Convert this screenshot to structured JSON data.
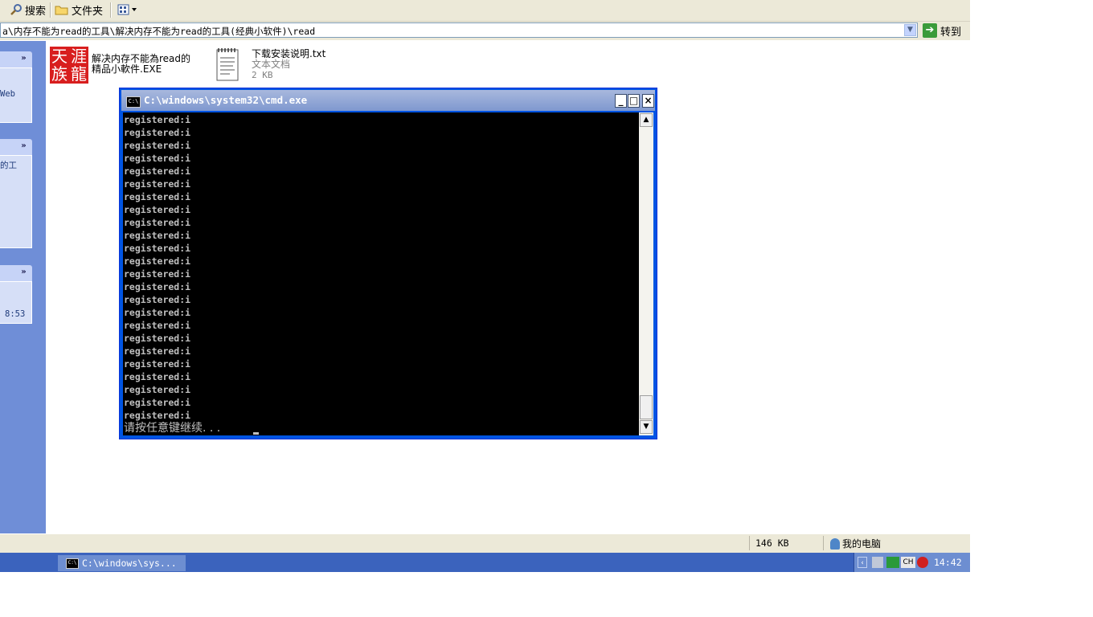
{
  "toolbar": {
    "search_label": "搜索",
    "folders_label": "文件夹"
  },
  "address": {
    "path": "a\\内存不能为read的工具\\解决内存不能为read的工具(经典小软件)\\read",
    "go_label": "转到"
  },
  "taskpane": {
    "section1_text": "Web",
    "section2_text": "的工",
    "section3_text": "8:53"
  },
  "files": [
    {
      "name_line1": "解决内存不能為read的",
      "name_line2": "精品小軟件.EXE",
      "icon_chars": [
        "天",
        "涯",
        "族",
        "龍"
      ]
    },
    {
      "name": "下载安装说明.txt",
      "type": "文本文档",
      "size": "2 KB"
    }
  ],
  "cmd": {
    "title": "C:\\windows\\system32\\cmd.exe",
    "icon_text": "C:\\",
    "lines": [
      "registered:i",
      "registered:i",
      "registered:i",
      "registered:i",
      "registered:i",
      "registered:i",
      "registered:i",
      "registered:i",
      "registered:i",
      "registered:i",
      "registered:i",
      "registered:i",
      "registered:i",
      "registered:i",
      "registered:i",
      "registered:i",
      "registered:i",
      "registered:i",
      "registered:i",
      "registered:i",
      "registered:i",
      "registered:i",
      "registered:i",
      "registered:i"
    ],
    "prompt": "请按任意键继续. . .",
    "minimize": "_",
    "maximize": "□",
    "close": "×"
  },
  "statusbar": {
    "size": "146 KB",
    "location": "我的电脑"
  },
  "taskbar": {
    "task_label": "C:\\windows\\sys...",
    "ime": "CH",
    "clock": "14:42"
  }
}
